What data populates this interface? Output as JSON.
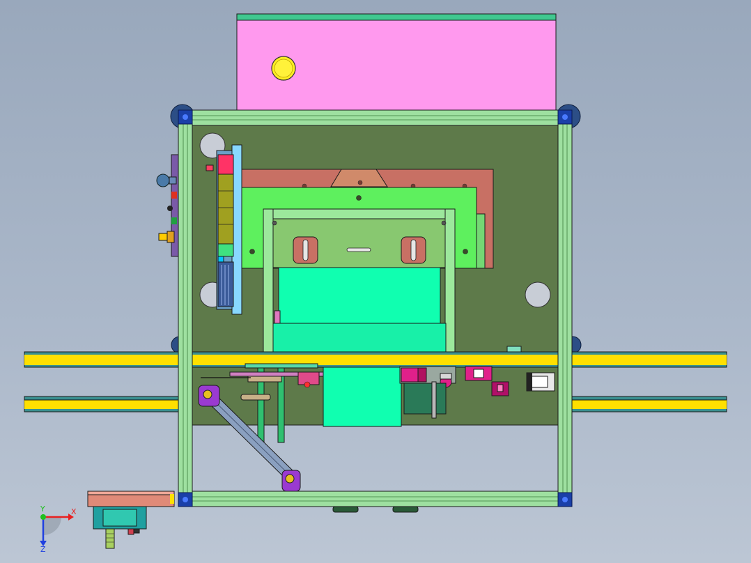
{
  "triad": {
    "x_label": "X",
    "y_label": "Y",
    "z_label": "Z",
    "x_color": "#e82020",
    "y_color": "#20c020",
    "z_color": "#2040e0"
  },
  "palette": {
    "aluminum_frame": "#9ee0a0",
    "base_plate": "#5e7a4a",
    "top_box": "#ff99ee",
    "yellow_rail": "#ffe000",
    "brown_plate": "#c87064",
    "green_plate": "#5ef05e",
    "light_green_frame": "#8cdc8c",
    "mint_block": "#10ffb0",
    "corner_blue": "#1a3fa8",
    "purple_link": "#9a3ad0",
    "sensor_pink": "#e0208a",
    "knob_yellow": "#ffee22"
  }
}
